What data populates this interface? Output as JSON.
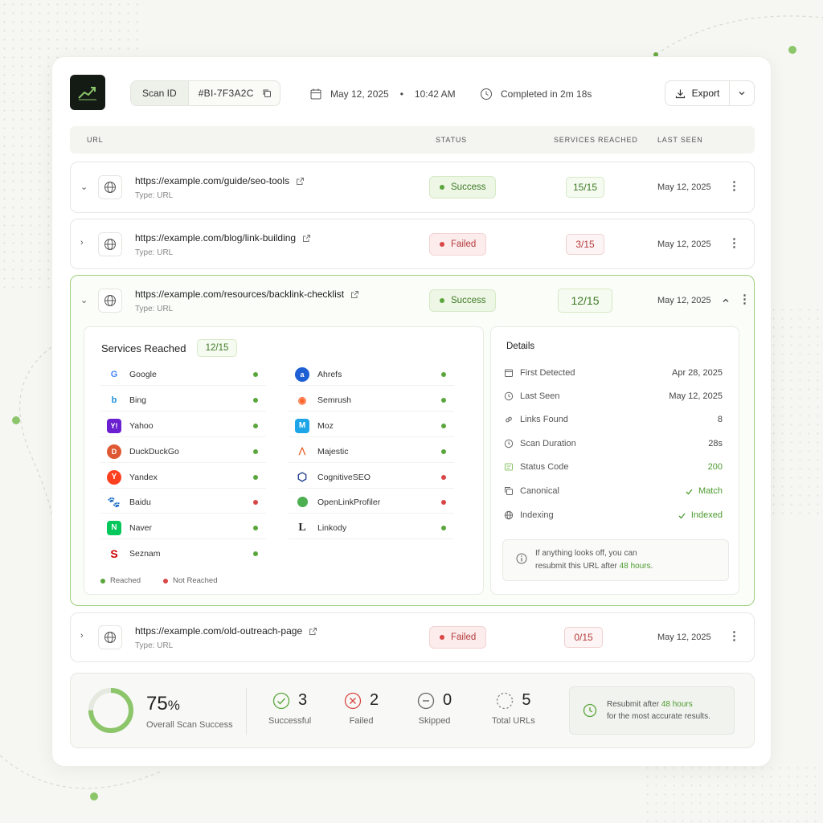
{
  "header": {
    "scan_id_label": "Scan ID",
    "scan_id_value": "#BI-7F3A2C",
    "date": "May 12, 2025",
    "time": "10:42 AM",
    "completed": "Completed in 2m 18s",
    "export_label": "Export"
  },
  "table": {
    "headers": {
      "url": "URL",
      "status": "STATUS",
      "services": "SERVICES REACHED",
      "last_seen": "LAST SEEN"
    },
    "rows": [
      {
        "url": "https://example.com/guide/seo-tools",
        "type": "Type: URL",
        "status": "Success",
        "services": "15/15",
        "date": "May 12, 2025"
      },
      {
        "url": "https://example.com/blog/link-building",
        "type": "Type: URL",
        "status": "Failed",
        "services": "3/15",
        "date": "May 12, 2025"
      },
      {
        "url": "https://example.com/resources/backlink-checklist",
        "type": "Type: URL",
        "status": "Success",
        "services": "12/15",
        "date": "May 12, 2025"
      },
      {
        "url": "https://example.com/old-outreach-page",
        "type": "Type: URL",
        "status": "Failed",
        "services": "0/15",
        "date": "May 12, 2025"
      }
    ]
  },
  "services_panel": {
    "title": "Services Reached",
    "count": "12/15",
    "left": [
      {
        "name": "Google",
        "icon": "google-icon"
      },
      {
        "name": "Bing",
        "icon": "bing-icon"
      },
      {
        "name": "Yahoo",
        "icon": "yahoo-icon"
      },
      {
        "name": "DuckDuckGo",
        "icon": "duckduckgo-icon"
      },
      {
        "name": "Yandex",
        "icon": "yandex-icon"
      },
      {
        "name": "Baidu",
        "icon": "baidu-icon"
      },
      {
        "name": "Naver",
        "icon": "naver-icon"
      },
      {
        "name": "Seznam",
        "icon": "seznam-icon"
      }
    ],
    "right": [
      {
        "name": "Ahrefs",
        "icon": "ahrefs-icon"
      },
      {
        "name": "Semrush",
        "icon": "semrush-icon"
      },
      {
        "name": "Moz",
        "icon": "moz-icon"
      },
      {
        "name": "Majestic",
        "icon": "majestic-icon"
      },
      {
        "name": "CognitiveSEO",
        "icon": "cognitiveseo-icon"
      },
      {
        "name": "OpenLinkProfiler",
        "icon": "openlinkprofiler-icon"
      },
      {
        "name": "Linkody",
        "icon": "linkody-icon"
      }
    ],
    "legend_reached": "Reached",
    "legend_not_reached": "Not Reached"
  },
  "details": {
    "title": "Details",
    "items": [
      {
        "label": "First Detected",
        "value": "Apr 28, 2025"
      },
      {
        "label": "Last Seen",
        "value": "May 12, 2025"
      },
      {
        "label": "Links Found",
        "value": "8"
      },
      {
        "label": "Scan Duration",
        "value": "28s"
      },
      {
        "label": "Status Code",
        "value": "200"
      },
      {
        "label": "Canonical",
        "value": "Match"
      },
      {
        "label": "Indexing",
        "value": "Indexed"
      }
    ],
    "note_line1": "If anything looks off, you can",
    "note_line2_pre": "resubmit this URL after",
    "note_hours": "48 hours",
    "note_dot": "."
  },
  "summary": {
    "percent": "75",
    "percent_sign": "%",
    "progress_value": 0.75,
    "percent_label": "Overall Scan Success",
    "successful": "3",
    "successful_label": "Successful",
    "failed": "2",
    "failed_label": "Failed",
    "skipped": "0",
    "skipped_label": "Skipped",
    "total": "5",
    "total_label": "Total URLs",
    "resubmit_pre": "Resubmit after",
    "resubmit_hours": "48 hours",
    "resubmit_line2": "for the most accurate results."
  },
  "colors": {
    "accent": "#5aa63c",
    "danger": "#d94646"
  }
}
